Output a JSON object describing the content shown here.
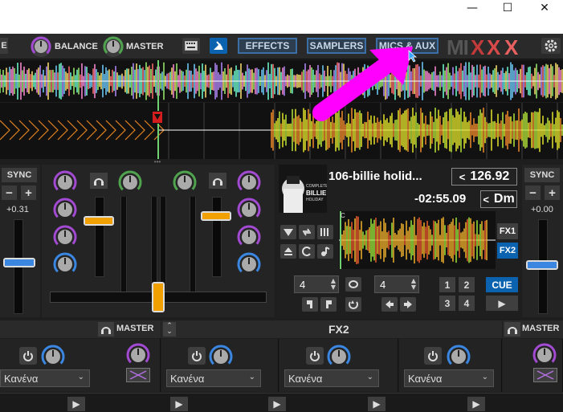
{
  "window": {
    "minimize": "—",
    "maximize": "☐",
    "close": "✕"
  },
  "toolbar": {
    "left_partial": "E",
    "balance_label": "BALANCE",
    "master_label": "MASTER",
    "effects_label": "EFFECTS",
    "samplers_label": "SAMPLERS",
    "mics_aux_label": "MICS & AUX",
    "logo_text": "MIXXX",
    "colors": {
      "button_border": "#3a6ea5",
      "button_bg": "#2c3e50",
      "logo_x": "#d93a3a"
    }
  },
  "deck_left": {
    "sync_label": "SYNC",
    "minus": "−",
    "plus": "+",
    "rate": "+0.31"
  },
  "deck_right": {
    "sync_label": "SYNC",
    "minus": "−",
    "plus": "+",
    "rate": "+0.00",
    "track_title": "106-billie holid...",
    "bpm": "126.92",
    "time_remaining": "-02:55.09",
    "key": "Dm",
    "bpm_prefix": "<",
    "key_prefix": "<",
    "album_text": "COMPLETE BILLIE HOLIDAY",
    "fx1": "FX1",
    "fx2": "FX2",
    "beatloop_value": "4",
    "beatjump_value": "4",
    "hotcues": [
      "1",
      "2",
      "3",
      "4"
    ],
    "cue_label": "CUE",
    "play_label": "▶",
    "waveform_cue_marker": "C"
  },
  "mixer": {
    "pfl_icon": "headphones",
    "crossfader_position": 0.5
  },
  "effects": {
    "unit_headers": [
      {
        "label": "MASTER"
      },
      {
        "label": "FX2"
      },
      {
        "label": "MASTER"
      }
    ],
    "slots": [
      {
        "effect": "Κανένα"
      },
      {
        "effect": "Κανένα"
      },
      {
        "effect": "Κανένα"
      },
      {
        "effect": "Κανένα"
      }
    ]
  },
  "annotation": {
    "arrow_color": "#ff00ff"
  }
}
